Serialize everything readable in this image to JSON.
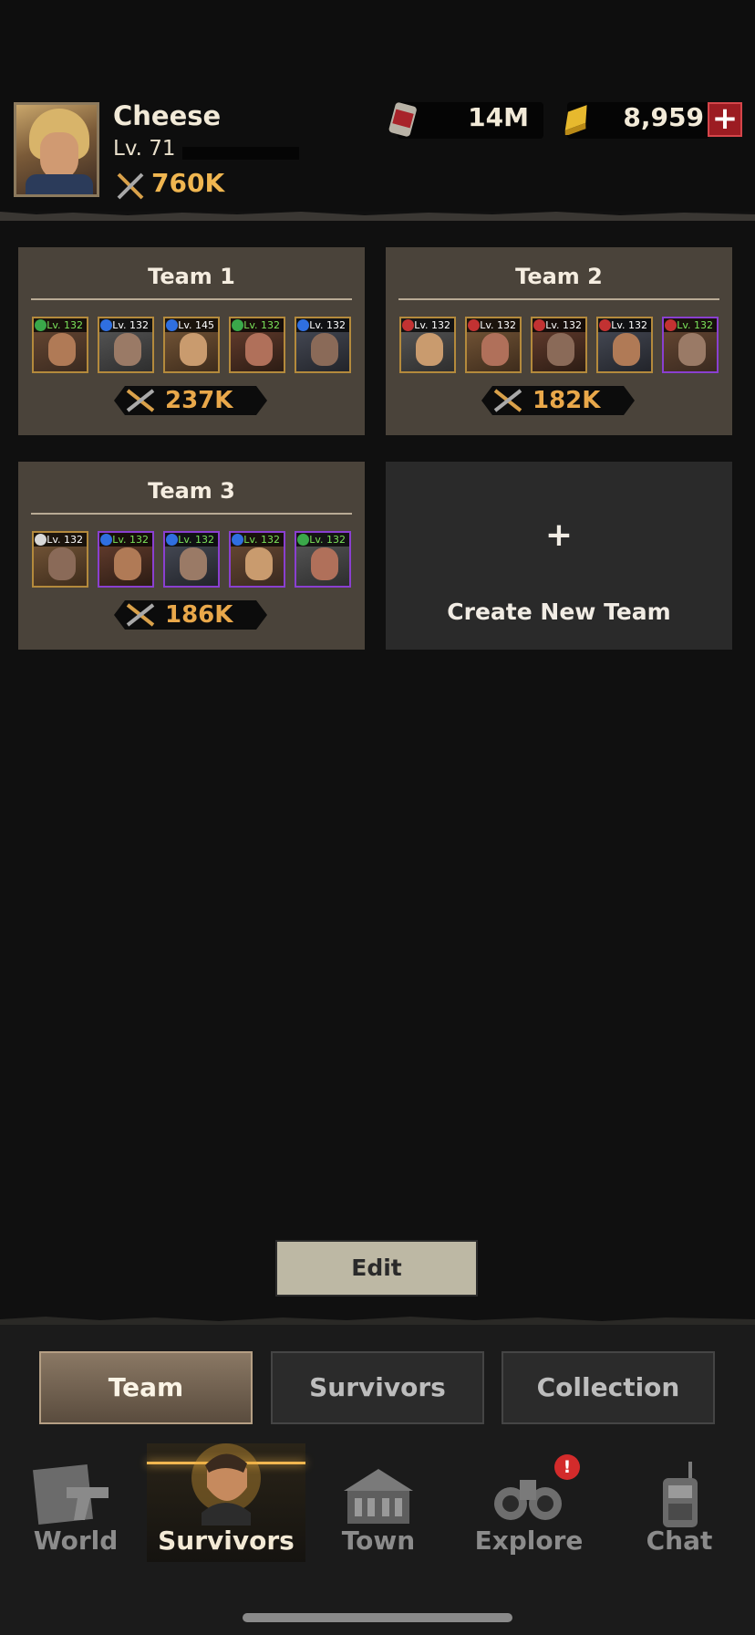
{
  "player": {
    "name": "Cheese",
    "level": "Lv. 71",
    "power": "760K"
  },
  "currencies": {
    "food": {
      "icon": "canned-food-icon",
      "value": "14M"
    },
    "gold": {
      "icon": "gold-bar-icon",
      "value": "8,959"
    },
    "add_label": "+"
  },
  "teams": [
    {
      "title": "Team 1",
      "power": "237K",
      "members": [
        {
          "level": "Lv. 132",
          "rarity": "gold",
          "faction": "green"
        },
        {
          "level": "Lv. 132",
          "rarity": "gold",
          "faction": "blue"
        },
        {
          "level": "Lv. 145",
          "rarity": "gold",
          "faction": "blue"
        },
        {
          "level": "Lv. 132",
          "rarity": "gold",
          "faction": "green"
        },
        {
          "level": "Lv. 132",
          "rarity": "gold",
          "faction": "blue"
        }
      ]
    },
    {
      "title": "Team 2",
      "power": "182K",
      "members": [
        {
          "level": "Lv. 132",
          "rarity": "gold",
          "faction": "red"
        },
        {
          "level": "Lv. 132",
          "rarity": "gold",
          "faction": "red"
        },
        {
          "level": "Lv. 132",
          "rarity": "gold",
          "faction": "red"
        },
        {
          "level": "Lv. 132",
          "rarity": "gold",
          "faction": "red"
        },
        {
          "level": "Lv. 132",
          "rarity": "purple",
          "faction": "red"
        }
      ]
    },
    {
      "title": "Team 3",
      "power": "186K",
      "members": [
        {
          "level": "Lv. 132",
          "rarity": "gold",
          "faction": "white"
        },
        {
          "level": "Lv. 132",
          "rarity": "purple",
          "faction": "blue"
        },
        {
          "level": "Lv. 132",
          "rarity": "purple",
          "faction": "blue"
        },
        {
          "level": "Lv. 132",
          "rarity": "purple",
          "faction": "blue"
        },
        {
          "level": "Lv. 132",
          "rarity": "purple",
          "faction": "green"
        }
      ]
    }
  ],
  "create_team": {
    "plus": "+",
    "label": "Create New Team"
  },
  "edit_label": "Edit",
  "subtabs": [
    {
      "label": "Team",
      "active": true
    },
    {
      "label": "Survivors",
      "active": false
    },
    {
      "label": "Collection",
      "active": false
    }
  ],
  "nav": [
    {
      "label": "World",
      "icon": "revolver-map-icon",
      "active": false
    },
    {
      "label": "Survivors",
      "icon": "survivor-portrait-icon",
      "active": true
    },
    {
      "label": "Town",
      "icon": "mansion-icon",
      "active": false
    },
    {
      "label": "Explore",
      "icon": "binoculars-icon",
      "active": false
    },
    {
      "label": "Chat",
      "icon": "walkie-talkie-icon",
      "active": false
    }
  ],
  "explore_alert": "!",
  "colors": {
    "accent_gold": "#f0b650",
    "card_bg": "#4a433a",
    "alert_red": "#d32b2b"
  }
}
